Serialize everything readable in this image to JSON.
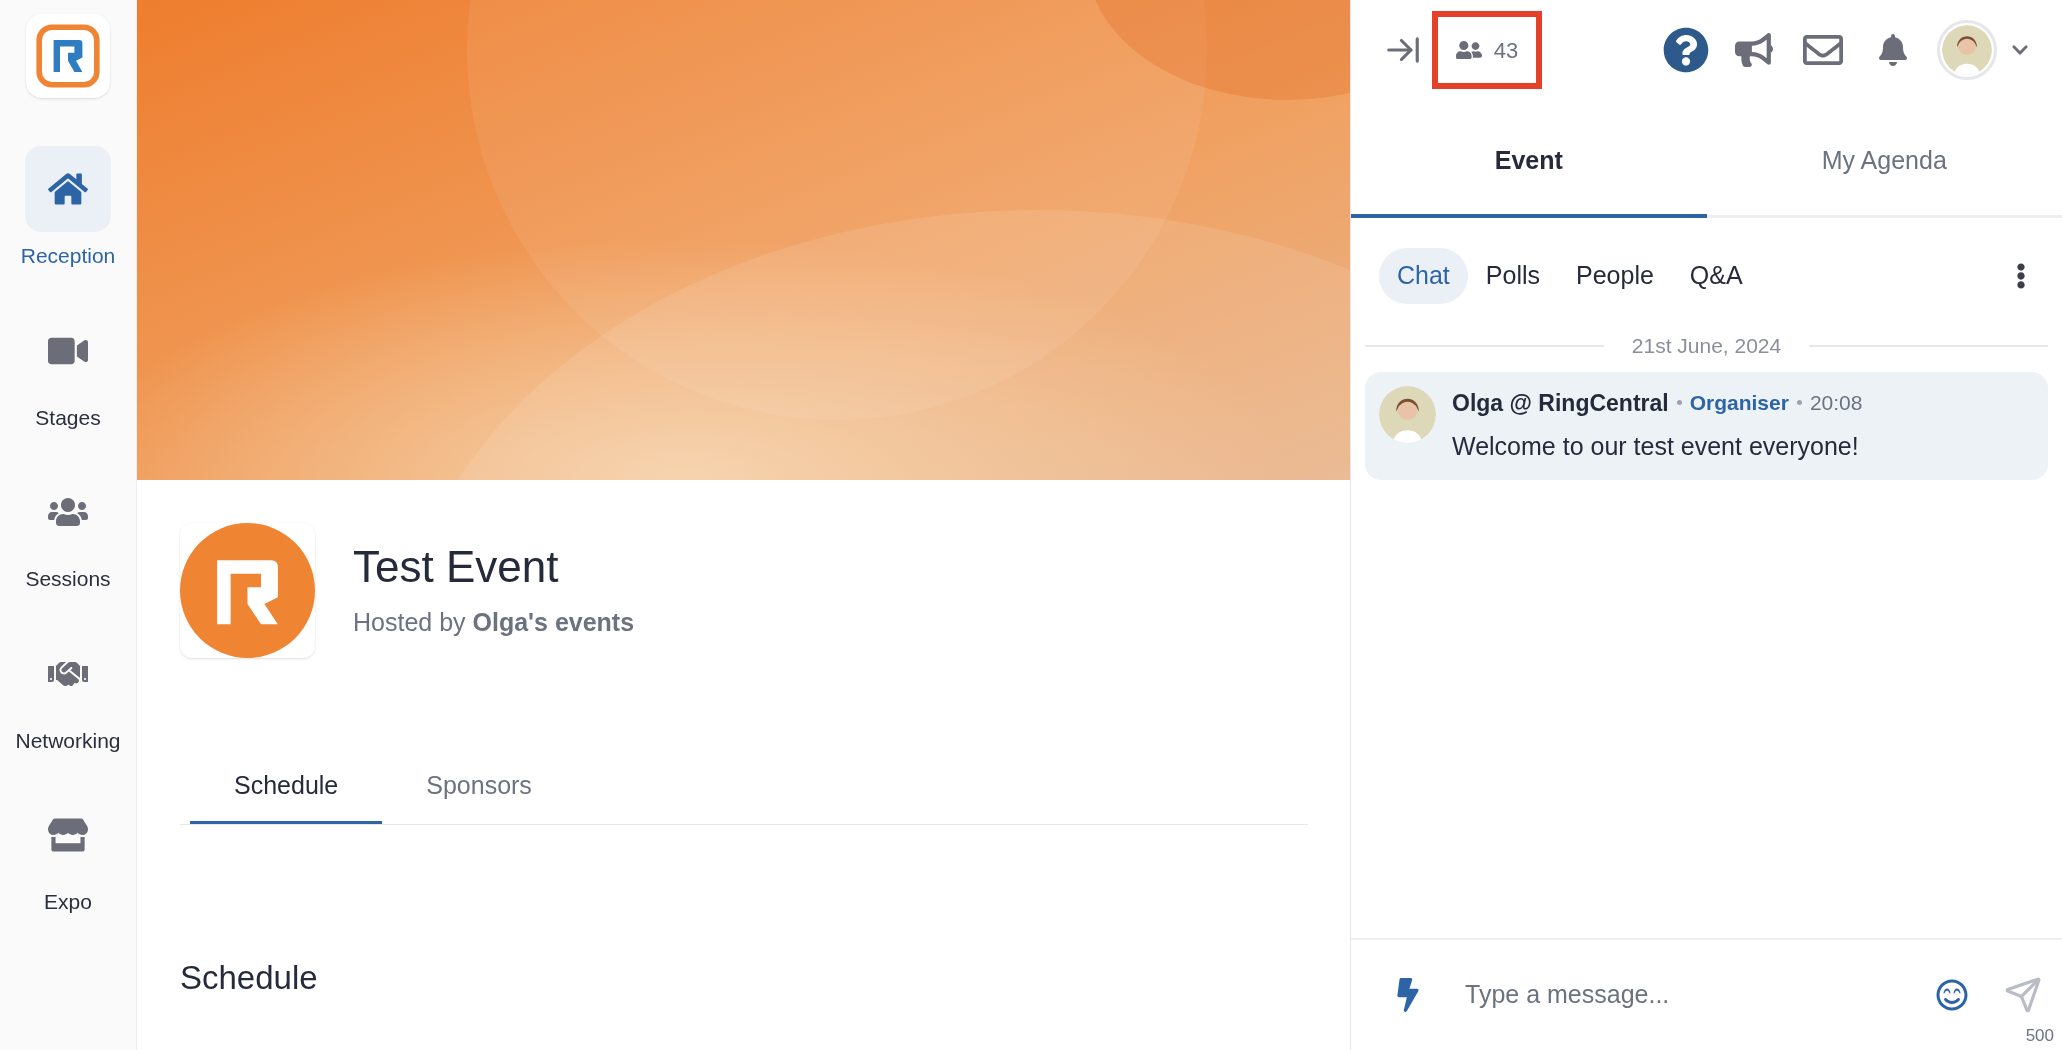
{
  "sidebar": {
    "items": [
      {
        "label": "Reception",
        "selected": true
      },
      {
        "label": "Stages",
        "selected": false
      },
      {
        "label": "Sessions",
        "selected": false
      },
      {
        "label": "Networking",
        "selected": false
      },
      {
        "label": "Expo",
        "selected": false
      }
    ]
  },
  "event": {
    "title": "Test Event",
    "host": "Hosted by **Olga's events**"
  },
  "event_tabs": [
    {
      "label": "Schedule",
      "selected": true
    },
    {
      "label": "Sponsors",
      "selected": false
    }
  ],
  "section_heading": "Schedule",
  "header": {
    "attendee_count": {
      "text": "43",
      "highlighted": true
    }
  },
  "panel_tabs": [
    {
      "label": "Event",
      "selected": true
    },
    {
      "label": "My Agenda",
      "selected": false
    }
  ],
  "chat_tabs": [
    {
      "label": "Chat",
      "selected": true
    },
    {
      "label": "Polls",
      "selected": false
    },
    {
      "label": "People",
      "selected": false
    },
    {
      "label": "Q&A",
      "selected": false
    }
  ],
  "date_divider": "21st June, 2024",
  "messages": [
    {
      "author": "Olga @ RingCentral",
      "role": "Organiser",
      "time": "20:08",
      "text": "Welcome to our test event everyone!"
    }
  ],
  "composer": {
    "placeholder": "Type a message...",
    "remaining": "500"
  }
}
